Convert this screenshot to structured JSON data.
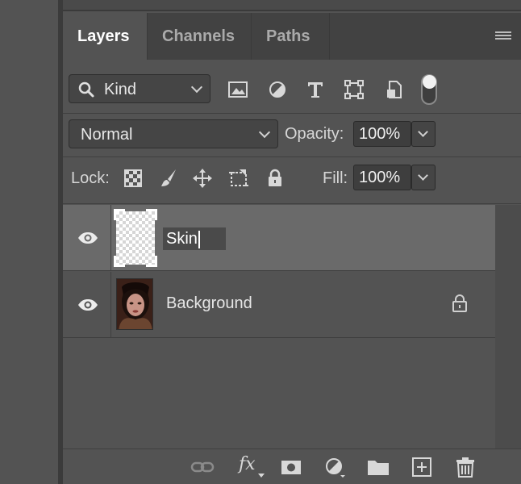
{
  "tabs": [
    {
      "label": "Layers",
      "active": true
    },
    {
      "label": "Channels",
      "active": false
    },
    {
      "label": "Paths",
      "active": false
    }
  ],
  "filter": {
    "kind_label": "Kind",
    "icons": [
      "pixel-filter-icon",
      "adjustment-filter-icon",
      "type-filter-icon",
      "shape-filter-icon",
      "smart-object-filter-icon"
    ]
  },
  "blend": {
    "mode": "Normal",
    "opacity_label": "Opacity:",
    "opacity_value": "100%"
  },
  "lock": {
    "label": "Lock:",
    "fill_label": "Fill:",
    "fill_value": "100%"
  },
  "layers": [
    {
      "name": "Skin",
      "visible": true,
      "selected": true,
      "editing": true,
      "locked": false
    },
    {
      "name": "Background",
      "visible": true,
      "selected": false,
      "editing": false,
      "locked": true
    }
  ],
  "footer_icons": [
    "link-layers-icon",
    "fx-icon",
    "add-mask-icon",
    "new-adjustment-icon",
    "new-group-icon",
    "new-layer-icon",
    "delete-layer-icon"
  ],
  "colors": {
    "panel": "#535353",
    "tab_bar": "#424242",
    "selected_row": "#6a6a6a"
  }
}
